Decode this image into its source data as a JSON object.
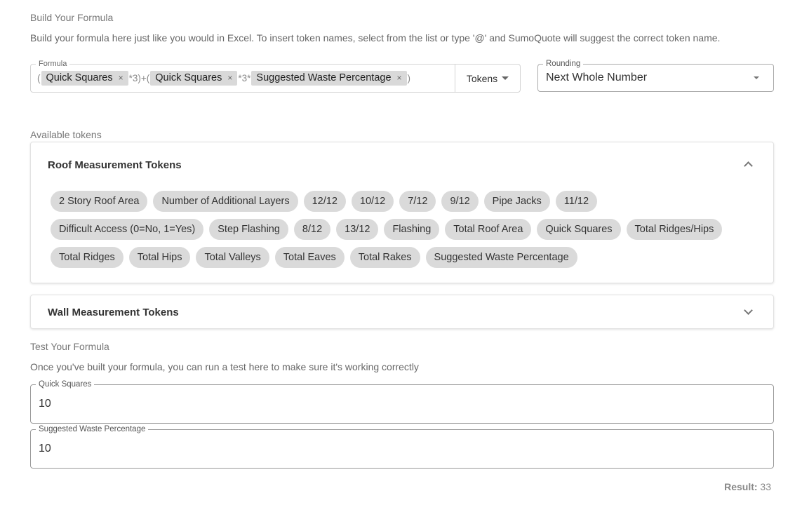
{
  "build": {
    "title": "Build Your Formula",
    "description": "Build your formula here just like you would in Excel. To insert token names, select from the list or type '@' and SumoQuote will suggest the correct token name."
  },
  "formula": {
    "label": "Formula",
    "op1": "(",
    "token1": "Quick Squares",
    "op2": "*3)+(",
    "token2": "Quick Squares",
    "op3": "*3*",
    "token3": "Suggested Waste Percentage",
    "op4": ")",
    "remove_symbol": "×",
    "tokens_button": "Tokens"
  },
  "rounding": {
    "label": "Rounding",
    "value": "Next Whole Number"
  },
  "available_tokens_label": "Available tokens",
  "roof": {
    "title": "Roof Measurement Tokens",
    "rows": [
      [
        "2 Story Roof Area",
        "Number of Additional Layers",
        "12/12",
        "10/12",
        "7/12",
        "9/12",
        "Pipe Jacks",
        "11/12"
      ],
      [
        "Difficult Access (0=No, 1=Yes)",
        "Step Flashing",
        "8/12",
        "13/12",
        "Flashing",
        "Total Roof Area",
        "Quick Squares",
        "Total Ridges/Hips"
      ],
      [
        "Total Ridges",
        "Total Hips",
        "Total Valleys",
        "Total Eaves",
        "Total Rakes",
        "Suggested Waste Percentage"
      ]
    ]
  },
  "wall": {
    "title": "Wall Measurement Tokens"
  },
  "test": {
    "title": "Test Your Formula",
    "description": "Once you've built your formula, you can run a test here to make sure it's working correctly",
    "fields": [
      {
        "label": "Quick Squares",
        "value": "10"
      },
      {
        "label": "Suggested Waste Percentage",
        "value": "10"
      }
    ]
  },
  "result": {
    "label": "Result:",
    "value": "33"
  }
}
